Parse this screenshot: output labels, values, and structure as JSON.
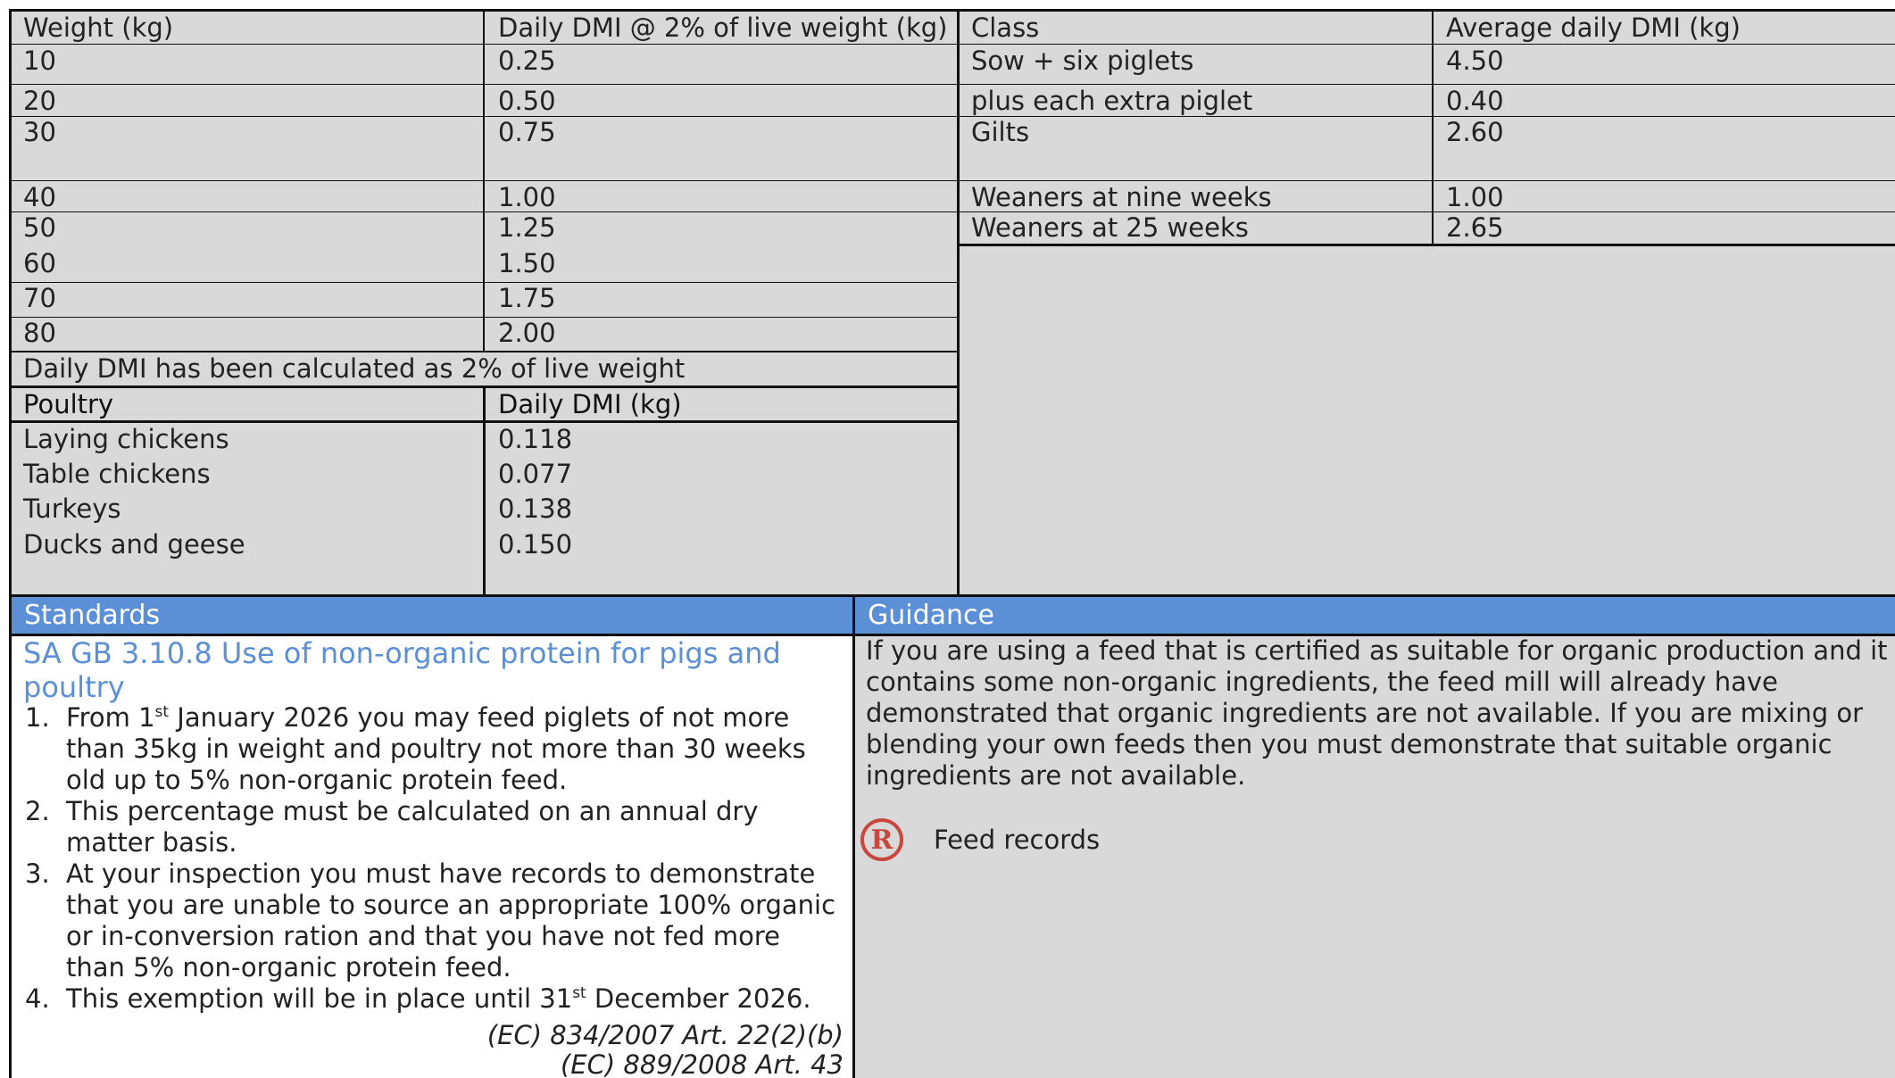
{
  "pig_weight_table": {
    "headers": [
      "Weight (kg)",
      "Daily DMI @ 2% of live weight (kg)"
    ],
    "rows": [
      [
        "10",
        "0.25"
      ],
      [
        "20",
        "0.50"
      ],
      [
        "30",
        "0.75"
      ],
      [
        "40",
        "1.00"
      ],
      [
        "50",
        "1.25"
      ],
      [
        "60",
        "1.50"
      ],
      [
        "70",
        "1.75"
      ],
      [
        "80",
        "2.00"
      ]
    ],
    "note": "Daily DMI has been calculated as 2% of live weight"
  },
  "class_table": {
    "headers": [
      "Class",
      "Average daily DMI (kg)"
    ],
    "rows": [
      [
        "Sow + six piglets",
        "4.50"
      ],
      [
        "plus each extra piglet",
        "0.40"
      ],
      [
        "Gilts",
        "2.60"
      ],
      [
        "Weaners at nine weeks",
        "1.00"
      ],
      [
        "Weaners at 25 weeks",
        "2.65"
      ]
    ]
  },
  "poultry_table": {
    "headers": [
      "Poultry",
      "Daily DMI (kg)"
    ],
    "rows": [
      [
        "Laying chickens",
        "0.118"
      ],
      [
        "Table chickens",
        "0.077"
      ],
      [
        "Turkeys",
        "0.138"
      ],
      [
        "Ducks and geese",
        "0.150"
      ]
    ]
  },
  "standards": {
    "header": "Standards",
    "title": "SA GB 3.10.8 Use of non-organic protein for pigs and poultry",
    "items": {
      "n1": "1.",
      "i1_a": "From 1",
      "i1_sup": "st",
      "i1_b": " January 2026 you may feed piglets of not more than 35kg in weight and poultry not more than 30 weeks old up to 5% non-organic protein feed.",
      "n2": "2.",
      "i2": "This percentage must be calculated on an annual dry matter basis.",
      "n3": "3.",
      "i3": "At your inspection you must have records to demonstrate that you are unable to source an appropriate 100% organic or in-conversion ration and that you have not fed more than 5% non-organic protein feed.",
      "n4": "4.",
      "i4_a": "This exemption will be in place until 31",
      "i4_sup": "st",
      "i4_b": " December 2026."
    },
    "references": [
      "(EC) 834/2007 Art. 22(2)(b)",
      "(EC) 889/2008 Art. 43"
    ]
  },
  "guidance": {
    "header": "Guidance",
    "text": "If you are using a feed that is certified as suitable for organic production and it contains some non-organic ingredients, the feed mill will already have demonstrated that organic ingredients are not available. If you are mixing or blending your own feeds then you must demonstrate that suitable organic ingredients are not available.",
    "record_icon_letter": "R",
    "record_label": "Feed records",
    "record_icon_color": "#c9473d"
  },
  "colors": {
    "header_blue": "#5b8fd6",
    "table_grey": "#d9d9d9"
  }
}
